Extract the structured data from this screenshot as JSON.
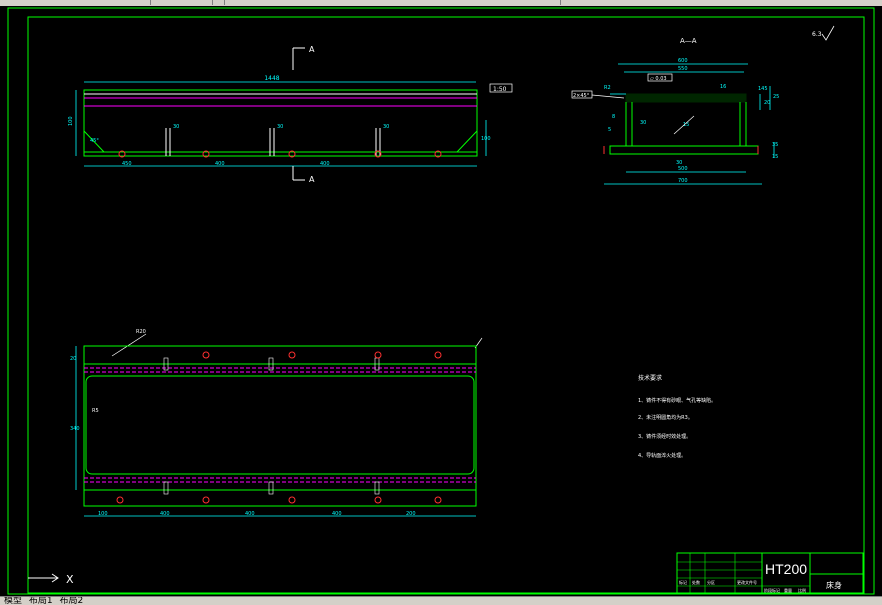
{
  "app": {
    "toolbar_fragment": "模 型 布 局"
  },
  "section_label": "A—A",
  "section_marks": {
    "top": "A",
    "bottom": "A"
  },
  "front_view": {
    "overall_length": "1448",
    "right_box": "1:50",
    "left_height": "100",
    "right_height": "100",
    "slot_labels": [
      "30",
      "30",
      "30"
    ],
    "bottom_dims": [
      "450",
      "400",
      "400"
    ],
    "chamfer": "45°"
  },
  "section_view": {
    "top_dims": [
      "600",
      "550"
    ],
    "labels": [
      "2×45°",
      "R2",
      "145",
      "16",
      "30",
      "5",
      "30",
      "15",
      "8"
    ],
    "flatness": "▱ 0.03",
    "bottom_dims": [
      "500",
      "700"
    ],
    "right_dims": [
      "20",
      "25",
      "35",
      "15"
    ],
    "roughness": "6.3"
  },
  "plan_view": {
    "corner_tag": "R20",
    "left_dims": [
      "20",
      "340"
    ],
    "inner_mark": "R5",
    "bottom_dims": [
      "100",
      "400",
      "400",
      "400",
      "200"
    ]
  },
  "tech_requirements": {
    "title": "技术要求",
    "items": [
      "1、铸件不得有砂眼、气孔等缺陷。",
      "2、未注明圆角均为R3。",
      "3、铸件须经时效处理。",
      "4、导轨面淬火处理。"
    ]
  },
  "title_block": {
    "material": "HT200",
    "part_name": "床身",
    "row_labels": [
      "标记",
      "处数",
      "分区",
      "更改文件号"
    ],
    "sign_labels": [
      "阶段标记",
      "重量",
      "比例"
    ]
  },
  "ucs": {
    "x": "X"
  },
  "tabs": [
    "模型",
    "布局1",
    "布局2"
  ],
  "colors": {
    "border": "#00ff00",
    "cyan": "#00ffff",
    "magenta": "#ff00ff",
    "red": "#ff3030",
    "white": "#ffffff",
    "bg": "#000000"
  }
}
